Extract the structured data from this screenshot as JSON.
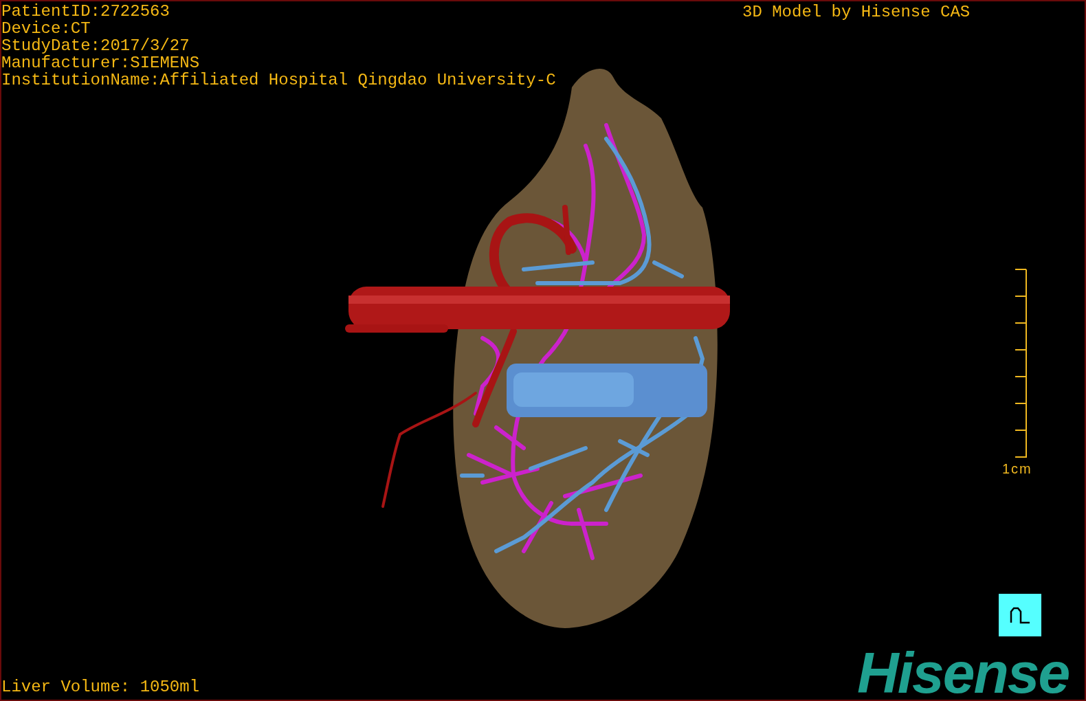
{
  "patient_info": [
    "PatientID:2722563",
    "Device:CT",
    "StudyDate:2017/3/27",
    "Manufacturer:SIEMENS",
    "InstitutionName:Affiliated Hospital Qingdao University-C"
  ],
  "header_right": "3D Model by Hisense CAS",
  "scale_bar": {
    "label": "1cm"
  },
  "liver_volume": "Liver Volume: 1050ml",
  "logo": "Hisense"
}
